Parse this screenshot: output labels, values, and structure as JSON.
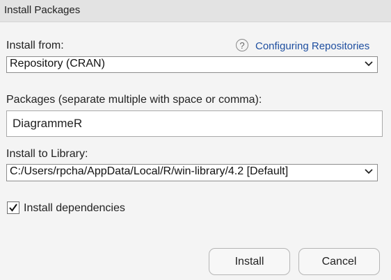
{
  "window": {
    "title": "Install Packages"
  },
  "install_from": {
    "label": "Install from:",
    "help_icon": "question-circle",
    "help_glyph": "?",
    "help_link": "Configuring Repositories",
    "selected": "Repository (CRAN)"
  },
  "packages": {
    "label": "Packages (separate multiple with space or comma):",
    "value": "DiagrammeR"
  },
  "library": {
    "label": "Install to Library:",
    "selected": "C:/Users/rpcha/AppData/Local/R/win-library/4.2 [Default]"
  },
  "dependencies": {
    "label": "Install dependencies",
    "checked": true
  },
  "buttons": {
    "install": "Install",
    "cancel": "Cancel"
  }
}
